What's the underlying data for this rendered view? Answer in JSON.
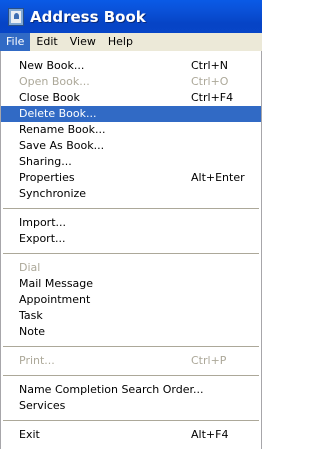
{
  "window": {
    "title": "Address Book"
  },
  "menubar": [
    "File",
    "Edit",
    "View",
    "Help"
  ],
  "menu": {
    "items": [
      {
        "label": "New Book...",
        "shortcut": "Ctrl+N"
      },
      {
        "label": "Open Book...",
        "shortcut": "Ctrl+O",
        "disabled": true
      },
      {
        "label": "Close Book",
        "shortcut": "Ctrl+F4"
      },
      {
        "label": "Delete Book...",
        "highlighted": true
      },
      {
        "label": "Rename Book..."
      },
      {
        "label": "Save As Book..."
      },
      {
        "label": "Sharing..."
      },
      {
        "label": "Properties",
        "shortcut": "Alt+Enter"
      },
      {
        "label": "Synchronize"
      },
      {
        "label": "Import..."
      },
      {
        "label": "Export..."
      },
      {
        "label": "Dial",
        "disabled": true
      },
      {
        "label": "Mail Message"
      },
      {
        "label": "Appointment"
      },
      {
        "label": "Task"
      },
      {
        "label": "Note"
      },
      {
        "label": "Print...",
        "shortcut": "Ctrl+P",
        "disabled": true
      },
      {
        "label": "Name Completion Search Order..."
      },
      {
        "label": "Services"
      },
      {
        "label": "Exit",
        "shortcut": "Alt+F4"
      }
    ]
  },
  "colors": {
    "titlebar": "#0a52d9",
    "highlight": "#316ac5",
    "disabled_text": "#aca899",
    "menubar": "#ece9d8"
  },
  "icons": {
    "app": "address-book-icon"
  }
}
